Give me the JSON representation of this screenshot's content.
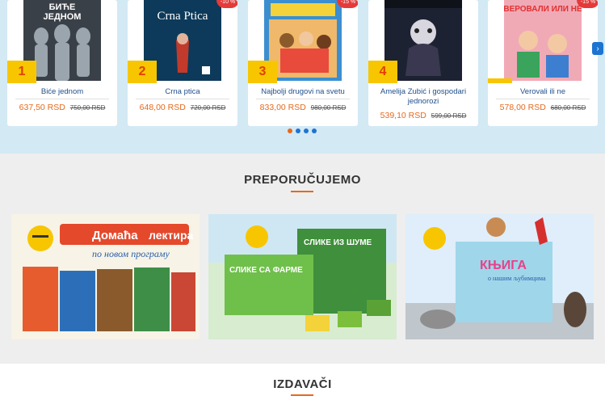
{
  "bestsellers": [
    {
      "rank": "1",
      "title": "Biće jednom",
      "price": "637,50 RSD",
      "old_price": "750,00 RSD",
      "discount": ""
    },
    {
      "rank": "2",
      "title": "Crna ptica",
      "price": "648,00 RSD",
      "old_price": "720,00 RSD",
      "discount": "-10 %",
      "cover_text": "Crna Ptica"
    },
    {
      "rank": "3",
      "title": "Najbolji drugovi na svetu",
      "price": "833,00 RSD",
      "old_price": "980,00 RSD",
      "discount": "-15 %"
    },
    {
      "rank": "4",
      "title": "Amelija Zubić i gospodari jednorozi",
      "price": "539,10 RSD",
      "old_price": "599,00 RSD",
      "discount": ""
    },
    {
      "rank": "",
      "title": "Verovali ili ne",
      "price": "578,00 RSD",
      "old_price": "680,00 RSD",
      "discount": "-15 %",
      "cover_text": "ВЕРОВАЛИ ИЛИ НЕ"
    }
  ],
  "carousel": {
    "next_icon": "chevron-right-icon",
    "dots": 4,
    "active_dot": 0
  },
  "sections": {
    "recommend_title": "PREPORUČUJEMO",
    "publishers_title": "IZDAVAČI"
  },
  "promos": [
    {
      "name": "domaca-lektira",
      "line1": "Домаћа",
      "line2": "лектира",
      "line3": "по новом програму"
    },
    {
      "name": "slike-sa-farme",
      "line1": "СЛИКЕ СА ФАРМЕ",
      "line2": "СЛИКЕ ИЗ ШУМЕ"
    },
    {
      "name": "knjiga-o-ljubimcima",
      "line1": "КЊИГА",
      "line2": "о нашим љубимцима"
    }
  ],
  "colors": {
    "accent": "#e56a1d",
    "link": "#1f4f8b",
    "rank_bg": "#f7c600",
    "band": "#d3e9f4"
  }
}
